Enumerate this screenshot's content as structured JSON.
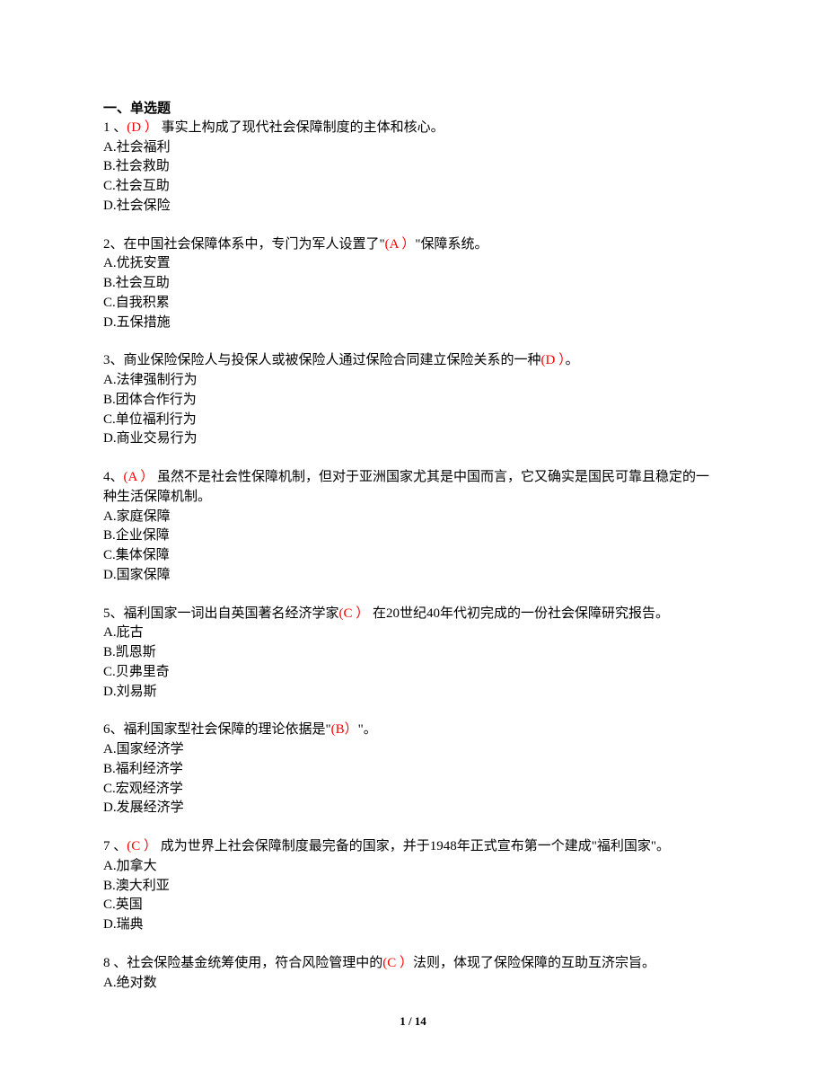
{
  "section_title": "一、单选题",
  "questions": [
    {
      "num": "1 、",
      "pre": "",
      "answer": "(D ）",
      "post": " 事实上构成了现代社会保障制度的主体和核心。",
      "options": [
        "A.社会福利",
        "B.社会救助",
        "C.社会互助",
        "D.社会保险"
      ]
    },
    {
      "num": "2、",
      "pre": "在中国社会保障体系中，专门为军人设置了\"",
      "answer": "(A ）",
      "post": "\"保障系统。",
      "options": [
        "A.优抚安置",
        "B.社会互助",
        "C.自我积累",
        "D.五保措施"
      ]
    },
    {
      "num": "3、",
      "pre": "商业保险保险人与投保人或被保险人通过保险合同建立保险关系的一种",
      "answer": "(D ）",
      "post": "。",
      "options": [
        "A.法律强制行为",
        "B.团体合作行为",
        "C.单位福利行为",
        "D.商业交易行为"
      ]
    },
    {
      "num": "4、",
      "pre": "",
      "answer": "(A ）",
      "post": " 虽然不是社会性保障机制，但对于亚洲国家尤其是中国而言，它又确实是国民可靠且稳定的一种生活保障机制。",
      "options": [
        "A.家庭保障",
        "B.企业保障",
        "C.集体保障",
        "D.国家保障"
      ]
    },
    {
      "num": "5、",
      "pre": "福利国家一词出自英国著名经济学家",
      "answer": "(C ）",
      "post": " 在20世纪40年代初完成的一份社会保障研究报告。",
      "options": [
        "A.庇古",
        "B.凯恩斯",
        "C.贝弗里奇",
        "D.刘易斯"
      ]
    },
    {
      "num": "6、",
      "pre": "福利国家型社会保障的理论依据是\"",
      "answer": "(B）",
      "post": "\"。",
      "options": [
        "A.国家经济学",
        "B.福利经济学",
        "C.宏观经济学",
        "D.发展经济学"
      ]
    },
    {
      "num": "7 、",
      "pre": "",
      "answer": "(C ）",
      "post": " 成为世界上社会保障制度最完备的国家，并于1948年正式宣布第一个建成\"福利国家\"。",
      "options": [
        "A.加拿大",
        "B.澳大利亚",
        "C.英国",
        "D.瑞典"
      ]
    },
    {
      "num": "8 、",
      "pre": "社会保险基金统筹使用，符合风险管理中的",
      "answer": "(C ）",
      "post": "法则，体现了保险保障的互助互济宗旨。",
      "options": [
        "A.绝对数"
      ]
    }
  ],
  "footer": "1 / 14"
}
